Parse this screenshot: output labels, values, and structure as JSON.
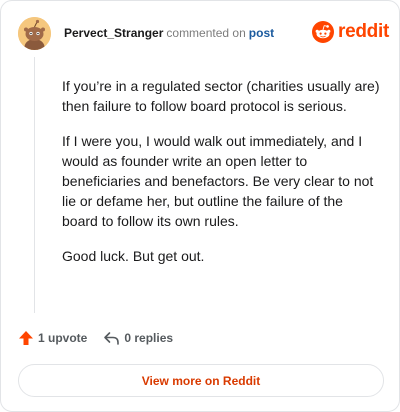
{
  "comment": {
    "author": "Pervect_Stranger",
    "verb": "commented on",
    "post_link": "post",
    "paragraphs": [
      "If you’re in a regulated sector (charities usually are) then failure to follow board protocol is serious.",
      "If I were you, I would walk out immediately, and I would as founder write an open letter to beneficiaries and benefactors. Be very clear to not lie or defame her, but outline the failure of the board to follow its own rules.",
      "Good luck. But get out."
    ]
  },
  "brand": {
    "name": "reddit",
    "color": "#ff4500"
  },
  "actions": {
    "upvotes": "1 upvote",
    "replies": "0 replies"
  },
  "footer": {
    "view_more_label": "View more on Reddit"
  }
}
